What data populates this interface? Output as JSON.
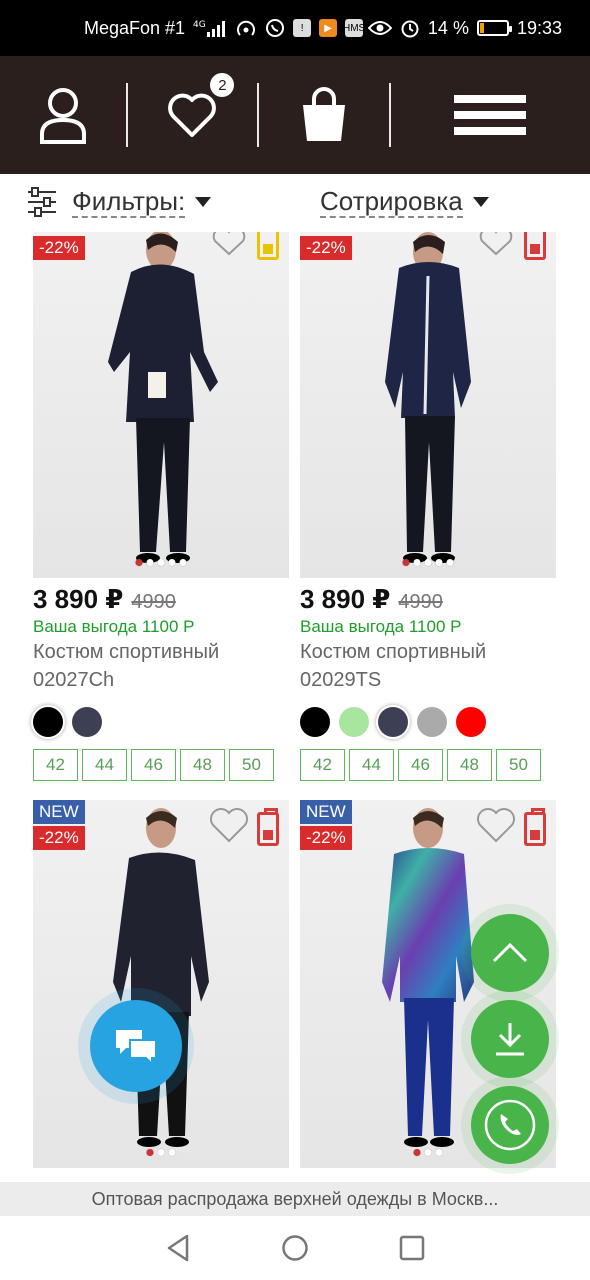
{
  "status_bar": {
    "carrier": "MegaFon #1",
    "network": "4G",
    "battery_percent": "14 %",
    "time": "19:33",
    "icons": [
      "signal-icon",
      "hotspot-icon",
      "whatsapp-icon",
      "alert-icon",
      "play-icon",
      "hms-icon",
      "eye-icon",
      "alarm-icon",
      "battery-icon"
    ]
  },
  "header": {
    "wishlist_count": "2",
    "icons": [
      "user-icon",
      "heart-icon",
      "shopping-bag-icon",
      "menu-icon"
    ]
  },
  "toolbar": {
    "filters_label": "Фильтры:",
    "sort_label": "Сотрировка"
  },
  "products": [
    {
      "discount": "-22%",
      "price": "3 890 ₽",
      "old_price": "4990",
      "benefit": "Ваша выгода 1100 Р",
      "name": "Костюм спортивный",
      "sku": "02027Ch",
      "colors": [
        "#000000",
        "#3d3f55"
      ],
      "sizes": [
        "42",
        "44",
        "46",
        "48",
        "50"
      ],
      "stock_color": "#e8c400"
    },
    {
      "discount": "-22%",
      "price": "3 890 ₽",
      "old_price": "4990",
      "benefit": "Ваша выгода 1100 Р",
      "name": "Костюм спортивный",
      "sku": "02029TS",
      "colors": [
        "#000000",
        "#a8e6a0",
        "#3d3f55",
        "#aaaaaa",
        "#ff0000"
      ],
      "sizes": [
        "42",
        "44",
        "46",
        "48",
        "50"
      ],
      "stock_color": "#d63c3c"
    },
    {
      "new_label": "NEW",
      "discount": "-22%",
      "stock_color": "#d63c3c"
    },
    {
      "new_label": "NEW",
      "discount": "-22%",
      "stock_color": "#d63c3c"
    }
  ],
  "url_bar": "Оптовая распродажа верхней одежды в Москв...",
  "nav_bar": [
    "back-icon",
    "home-icon",
    "recents-icon"
  ],
  "accent": {
    "header_bg": "#2a1f1d",
    "green": "#48b44a",
    "chat_blue": "#26a3e0",
    "discount_red": "#d92b2b",
    "new_blue": "#3a5fa9"
  }
}
